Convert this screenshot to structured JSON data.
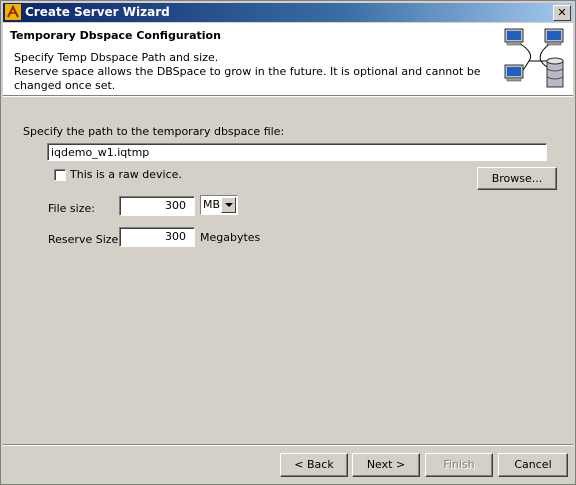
{
  "window": {
    "title": "Create Server Wizard",
    "close_glyph": "✕"
  },
  "header": {
    "title": "Temporary Dbspace Configuration",
    "line1": "Specify Temp Dbspace Path and size.",
    "line2": "Reserve space allows the DBSpace to grow in the future.  It is optional and cannot be changed once set.",
    "icon": "network-database-icon"
  },
  "form": {
    "path_label": "Specify the path to the temporary dbspace file:",
    "path_value": "iqdemo_w1.iqtmp",
    "raw_device_label": "This is a raw device.",
    "raw_device_checked": false,
    "browse_label": "Browse...",
    "file_size_label": "File size:",
    "file_size_value": "300",
    "file_size_unit": "MB",
    "reserve_label": "Reserve Size:",
    "reserve_value": "300",
    "reserve_unit": "Megabytes"
  },
  "buttons": {
    "back": "< Back",
    "next": "Next >",
    "finish": "Finish",
    "cancel": "Cancel"
  },
  "colors": {
    "titlebar": "#0a246a",
    "face": "#d4d0c8"
  }
}
